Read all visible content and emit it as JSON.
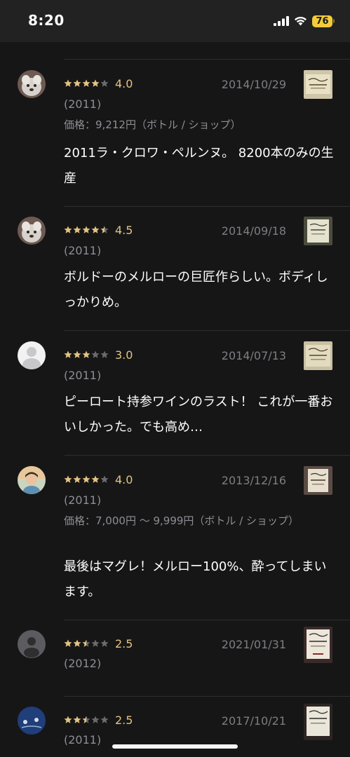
{
  "status": {
    "time": "8:20",
    "battery": "76"
  },
  "reviews": [
    {
      "rating": 4.0,
      "rating_label": "4.0",
      "date": "2014/10/29",
      "vintage": "(2011)",
      "price": "価格：9,212円（ボトル / ショップ）",
      "comment": "2011ラ・クロワ・ペルンヌ。 8200本のみの生産",
      "avatar": "dog-photo"
    },
    {
      "rating": 4.5,
      "rating_label": "4.5",
      "date": "2014/09/18",
      "vintage": "(2011)",
      "price": "",
      "comment": "ボルドーのメルローの巨匠作らしい。ボディしっかりめ。",
      "avatar": "dog-photo"
    },
    {
      "rating": 3.0,
      "rating_label": "3.0",
      "date": "2014/07/13",
      "vintage": "(2011)",
      "price": "",
      "comment": "ピーロート持参ワインのラスト！ これが一番おいしかった。でも高め…",
      "avatar": "default-user"
    },
    {
      "rating": 4.0,
      "rating_label": "4.0",
      "date": "2013/12/16",
      "vintage": "(2011)",
      "price": "価格：7,000円 ～ 9,999円（ボトル / ショップ）",
      "comment": "最後はマグレ！メルロー100%、酔ってしまいます。",
      "avatar": "person-photo"
    },
    {
      "rating": 2.5,
      "rating_label": "2.5",
      "date": "2021/01/31",
      "vintage": "(2012)",
      "price": "",
      "comment": "",
      "avatar": "default-user-gray"
    },
    {
      "rating": 2.5,
      "rating_label": "2.5",
      "date": "2017/10/21",
      "vintage": "(2011)",
      "price": "",
      "comment": "",
      "avatar": "blue-pattern"
    }
  ],
  "colors": {
    "background": "#161617",
    "star_filled": "#e4c381",
    "star_empty": "#6b6b6f",
    "date_text": "#7e7e82",
    "meta_text": "#8e8e93",
    "battery": "#f2cc3c"
  }
}
